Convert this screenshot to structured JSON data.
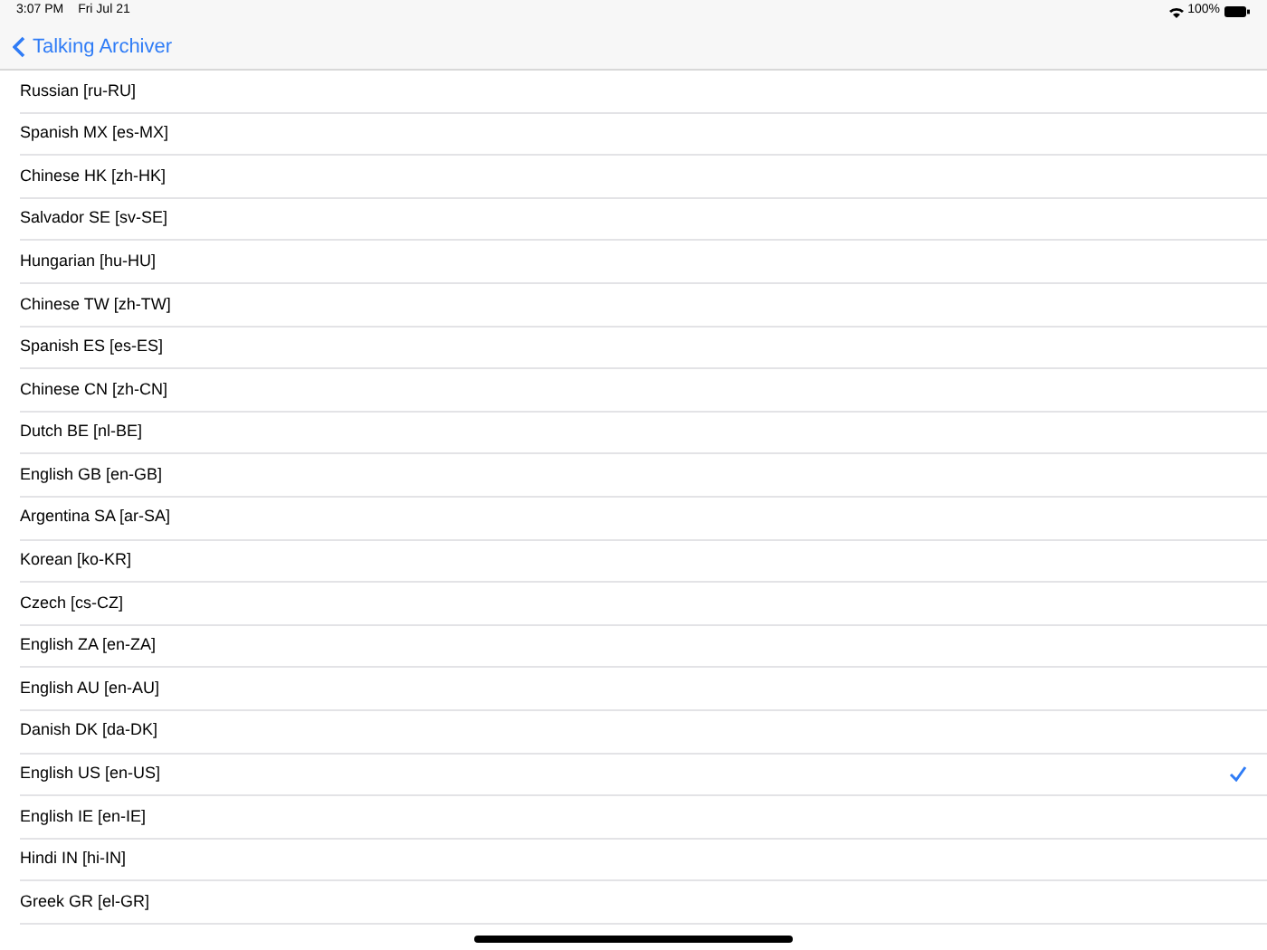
{
  "status_bar": {
    "time": "3:07 PM",
    "date": "Fri Jul 21",
    "battery": "100%"
  },
  "nav": {
    "back_label": "Talking Archiver"
  },
  "languages": [
    {
      "label": "Russian [ru-RU]",
      "selected": false
    },
    {
      "label": "Spanish MX [es-MX]",
      "selected": false
    },
    {
      "label": "Chinese HK [zh-HK]",
      "selected": false
    },
    {
      "label": "Salvador SE [sv-SE]",
      "selected": false
    },
    {
      "label": "Hungarian [hu-HU]",
      "selected": false
    },
    {
      "label": "Chinese TW [zh-TW]",
      "selected": false
    },
    {
      "label": "Spanish ES [es-ES]",
      "selected": false
    },
    {
      "label": "Chinese CN [zh-CN]",
      "selected": false
    },
    {
      "label": "Dutch BE [nl-BE]",
      "selected": false
    },
    {
      "label": "English GB [en-GB]",
      "selected": false
    },
    {
      "label": "Argentina SA [ar-SA]",
      "selected": false
    },
    {
      "label": "Korean [ko-KR]",
      "selected": false
    },
    {
      "label": "Czech [cs-CZ]",
      "selected": false
    },
    {
      "label": "English ZA [en-ZA]",
      "selected": false
    },
    {
      "label": "English AU [en-AU]",
      "selected": false
    },
    {
      "label": "Danish DK [da-DK]",
      "selected": false
    },
    {
      "label": "English US [en-US]",
      "selected": true
    },
    {
      "label": "English IE [en-IE]",
      "selected": false
    },
    {
      "label": "Hindi IN [hi-IN]",
      "selected": false
    },
    {
      "label": "Greek GR [el-GR]",
      "selected": false
    }
  ]
}
